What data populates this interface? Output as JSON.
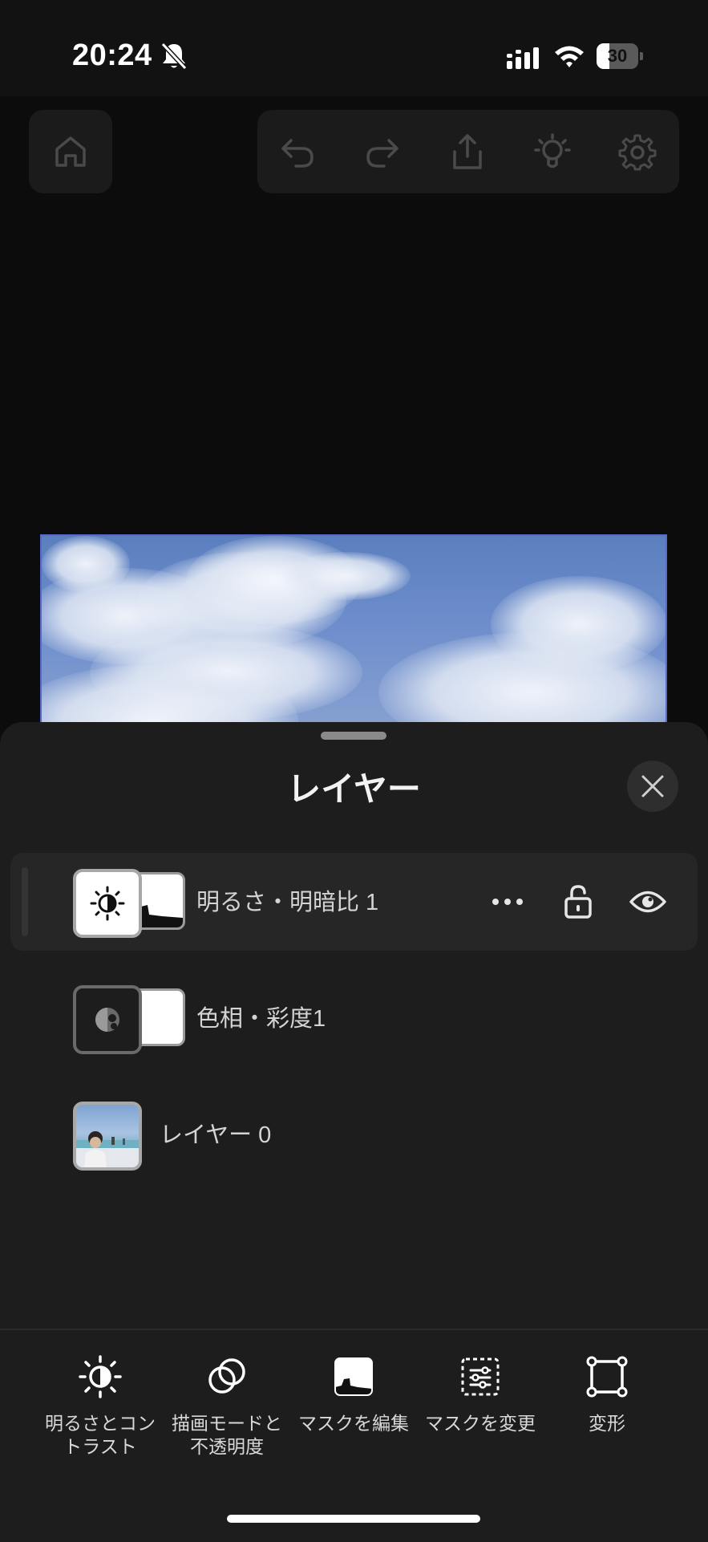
{
  "status_bar": {
    "time": "20:24",
    "battery_level": "30",
    "battery_fraction": 0.3
  },
  "toolbar": {
    "icons": [
      "home-icon",
      "undo-icon",
      "redo-icon",
      "share-icon",
      "lightbulb-icon",
      "gear-icon"
    ]
  },
  "layers_panel": {
    "title": "レイヤー",
    "layers": [
      {
        "name": "明るさ・明暗比 1",
        "selected": true,
        "thumb_icon": "brightness-icon"
      },
      {
        "name": "色相・彩度1",
        "selected": false,
        "thumb_icon": "hue-saturation-icon"
      },
      {
        "name": "レイヤー 0",
        "selected": false,
        "thumb_icon": "photo-thumbnail"
      }
    ]
  },
  "actions": {
    "brightness": "明るさとコン\nトラスト",
    "blend": "描画モードと\n不透明度",
    "edit_mask": "マスクを編集",
    "change_mask": "マスクを変更",
    "transform": "変形"
  },
  "colors": {
    "background": "#0c0c0c",
    "sheet": "#1d1d1d",
    "selection_border": "#5a6ac8"
  }
}
